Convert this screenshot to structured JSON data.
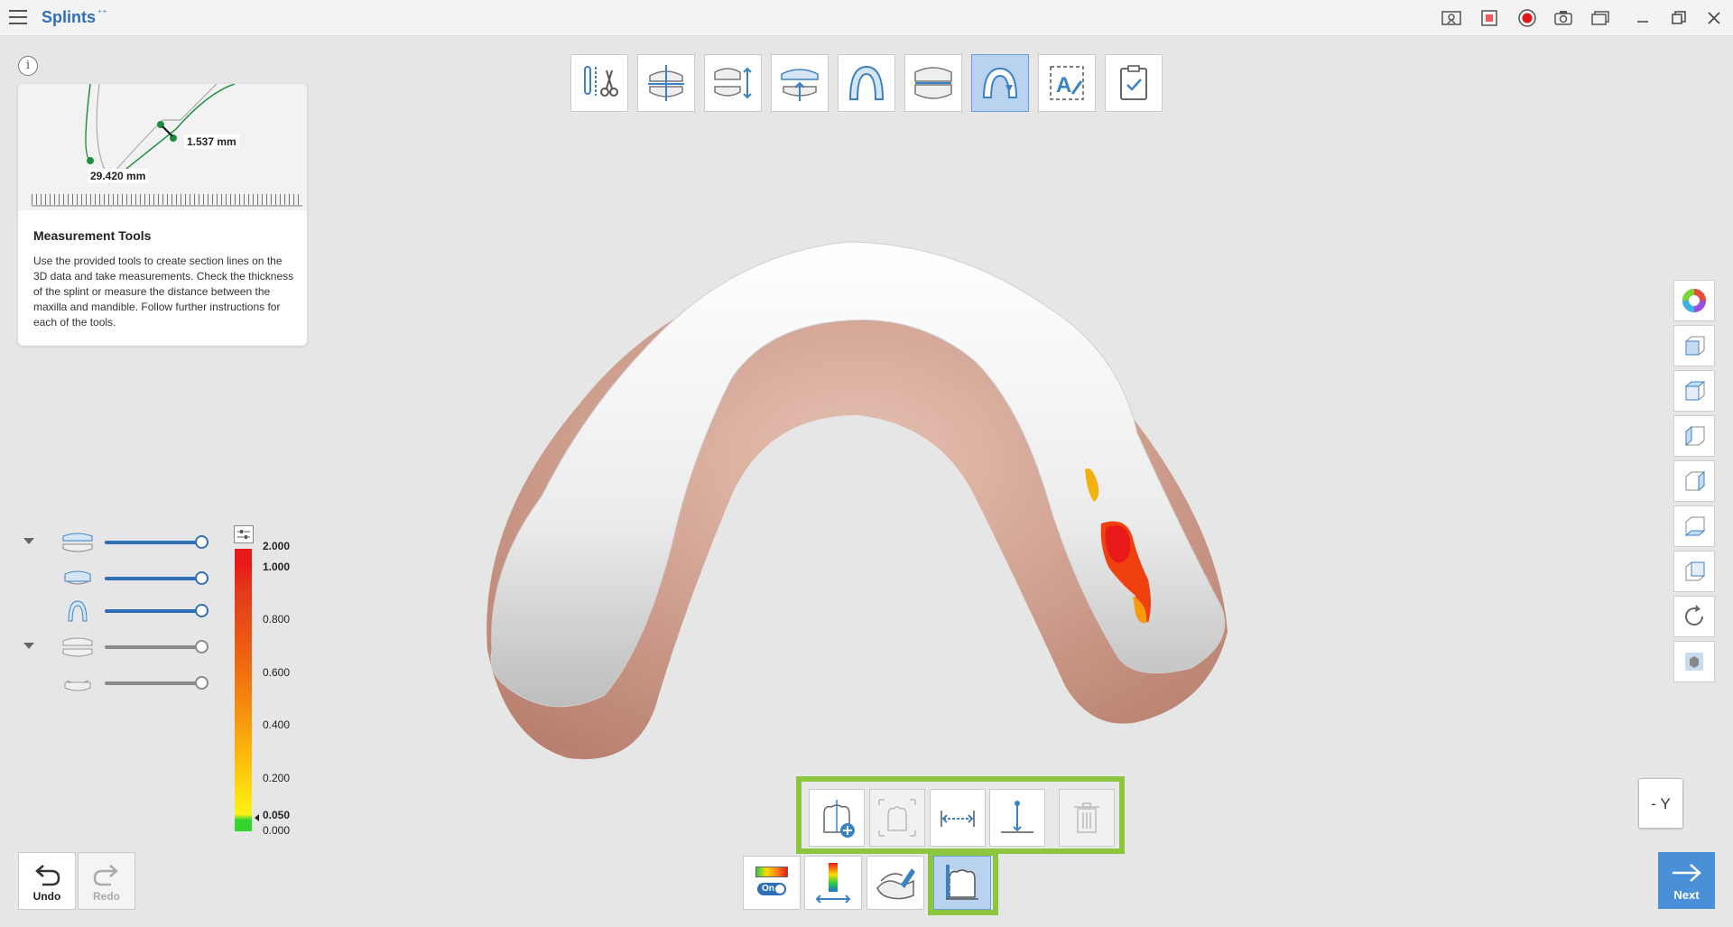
{
  "app": {
    "title": "Splints",
    "badge": "⁺⁺"
  },
  "info": {
    "illustration": {
      "measure_1": "1.537 mm",
      "measure_2": "29.420 mm"
    },
    "title": "Measurement Tools",
    "text": "Use the provided tools to create section lines on the 3D data and take measurements. Check the thickness of the splint or measure the distance between the maxilla and mandible. Follow further instructions for each of the tools."
  },
  "top_toolbar": [
    {
      "name": "trim-tool",
      "icon": "trim-icon",
      "active": false
    },
    {
      "name": "alignment-tool",
      "icon": "alignment-icon",
      "active": false
    },
    {
      "name": "bite-adjust-tool",
      "icon": "bite-adjust-icon",
      "active": false
    },
    {
      "name": "insertion-direction-tool",
      "icon": "insertion-direction-icon",
      "active": false
    },
    {
      "name": "arch-outline-tool",
      "icon": "arch-outline-icon",
      "active": false
    },
    {
      "name": "splint-design-tool",
      "icon": "splint-design-icon",
      "active": false
    },
    {
      "name": "splint-edit-tool",
      "icon": "splint-edit-icon",
      "active": true
    },
    {
      "name": "text-label-tool",
      "icon": "text-label-icon",
      "active": false
    },
    {
      "name": "review-tool",
      "icon": "checklist-icon",
      "active": false
    }
  ],
  "legend": {
    "labels": [
      {
        "value": "2.000",
        "bold": true
      },
      {
        "value": "1.000",
        "bold": true
      },
      {
        "value": "0.800",
        "bold": false
      },
      {
        "value": "0.600",
        "bold": false
      },
      {
        "value": "0.400",
        "bold": false
      },
      {
        "value": "0.200",
        "bold": false
      },
      {
        "value": "0.050",
        "bold": true
      },
      {
        "value": "0.000",
        "bold": false
      }
    ]
  },
  "layers": [
    {
      "name": "maxilla-group",
      "level": 1,
      "fraction": 1.0,
      "color": "#2f6fb7"
    },
    {
      "name": "maxilla-scan",
      "level": 1,
      "fraction": 1.0,
      "color": "#2f6fb7"
    },
    {
      "name": "splint",
      "level": 1,
      "fraction": 1.0,
      "color": "#2f6fb7"
    },
    {
      "name": "mandible-group",
      "level": 1,
      "fraction": 1.0,
      "color": "#8a8a8a"
    },
    {
      "name": "mandible-scan",
      "level": 1,
      "fraction": 1.0,
      "color": "#8a8a8a"
    }
  ],
  "history": {
    "undo": "Undo",
    "redo": "Redo"
  },
  "measure_tools": [
    {
      "name": "add-section-tool",
      "icon": "add-section-icon",
      "enabled": true
    },
    {
      "name": "section-view-tool",
      "icon": "section-view-icon",
      "enabled": false
    },
    {
      "name": "horizontal-measure-tool",
      "icon": "horizontal-measure-icon",
      "enabled": true
    },
    {
      "name": "vertical-measure-tool",
      "icon": "vertical-measure-icon",
      "enabled": true
    },
    {
      "name": "delete-measure-tool",
      "icon": "trash-icon",
      "enabled": false
    }
  ],
  "bottom_tools": {
    "color_toggle": "On"
  },
  "orientation": "- Y",
  "next": "Next",
  "colors": {
    "accent": "#2f6fb7",
    "highlight": "#8cc63f",
    "next": "#4a90d9"
  }
}
